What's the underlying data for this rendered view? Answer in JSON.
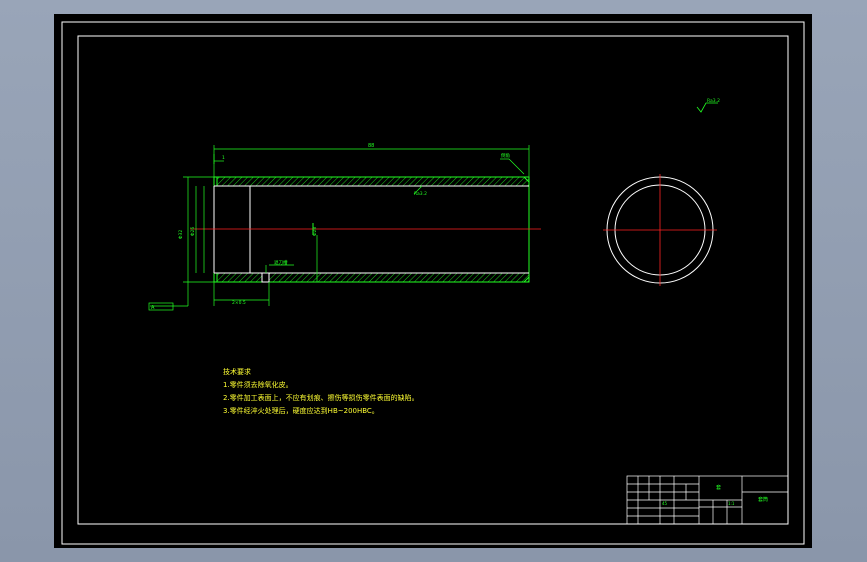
{
  "tech_requirements": {
    "title": "技术要求",
    "items": [
      "1.零件须去除氧化皮。",
      "2.零件加工表面上，不应有划痕、擦伤等损伤零件表面的缺陷。",
      "3.零件经淬火处理后，硬度应达到HB~200HBC。"
    ]
  },
  "annotations": {
    "overall_length": "88",
    "chamfer": "倒角",
    "roughness_top_right": "Ra3.2",
    "roughness_bore": "Ra3.2",
    "groove": "退刀槽",
    "small_dim": "1",
    "bottom_dim": "2×0.5",
    "datum_label": "A",
    "diameter_outer": "Φ32",
    "diameter_inner": "Φ26",
    "diameter_center": "Φ28"
  },
  "title_block": {
    "part_name": "套",
    "drawing_no": "套筒",
    "scale": "1:1",
    "material": "45"
  },
  "colors": {
    "outline": "#22ff22",
    "centerline": "#ff2222",
    "notes": "#ffff33",
    "frame": "#ffffff",
    "hatch": "#22ff22"
  }
}
